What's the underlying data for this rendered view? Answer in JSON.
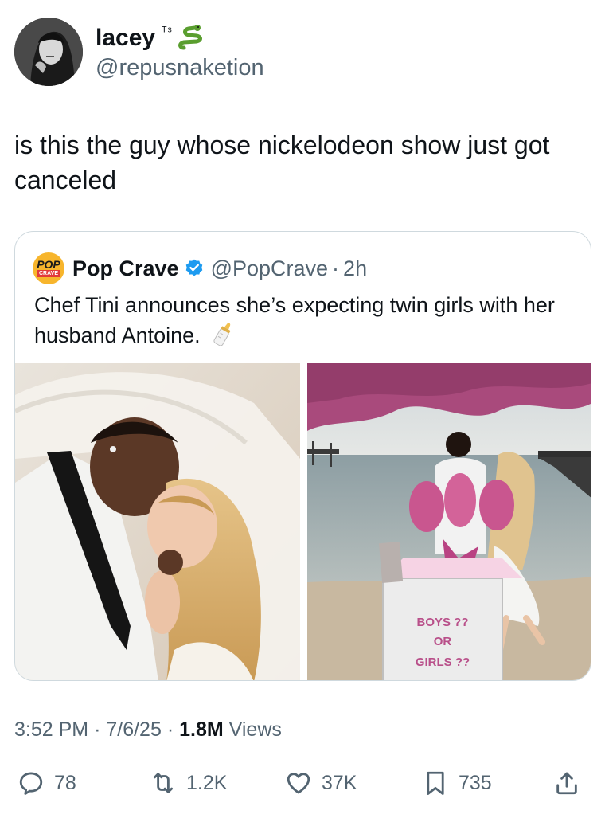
{
  "author": {
    "display_name": "lacey",
    "name_suffix": "ᵀˢ",
    "handle": "@repusnaketion"
  },
  "tweet": {
    "text": "is this the guy whose nickelodeon show just got canceled"
  },
  "quote": {
    "logo_top": "POP",
    "logo_bottom": "CRAVE",
    "name": "Pop Crave",
    "handle": "@PopCrave",
    "separator": "·",
    "time": "2h",
    "text": "Chef Tini announces she’s expecting twin girls with her husband Antoine.",
    "box_text_1": "BOYS ??",
    "box_text_2": "OR",
    "box_text_3": "GIRLS ??"
  },
  "meta": {
    "time": "3:52 PM",
    "sep1": "·",
    "date": "7/6/25",
    "sep2": "·",
    "views_count": "1.8M",
    "views_label": "Views"
  },
  "actions": {
    "replies": "78",
    "reposts": "1.2K",
    "likes": "37K",
    "bookmarks": "735"
  },
  "colors": {
    "text": "#0f1419",
    "secondary": "#536471",
    "border": "#cfd9de",
    "verified": "#1d9bf0"
  }
}
